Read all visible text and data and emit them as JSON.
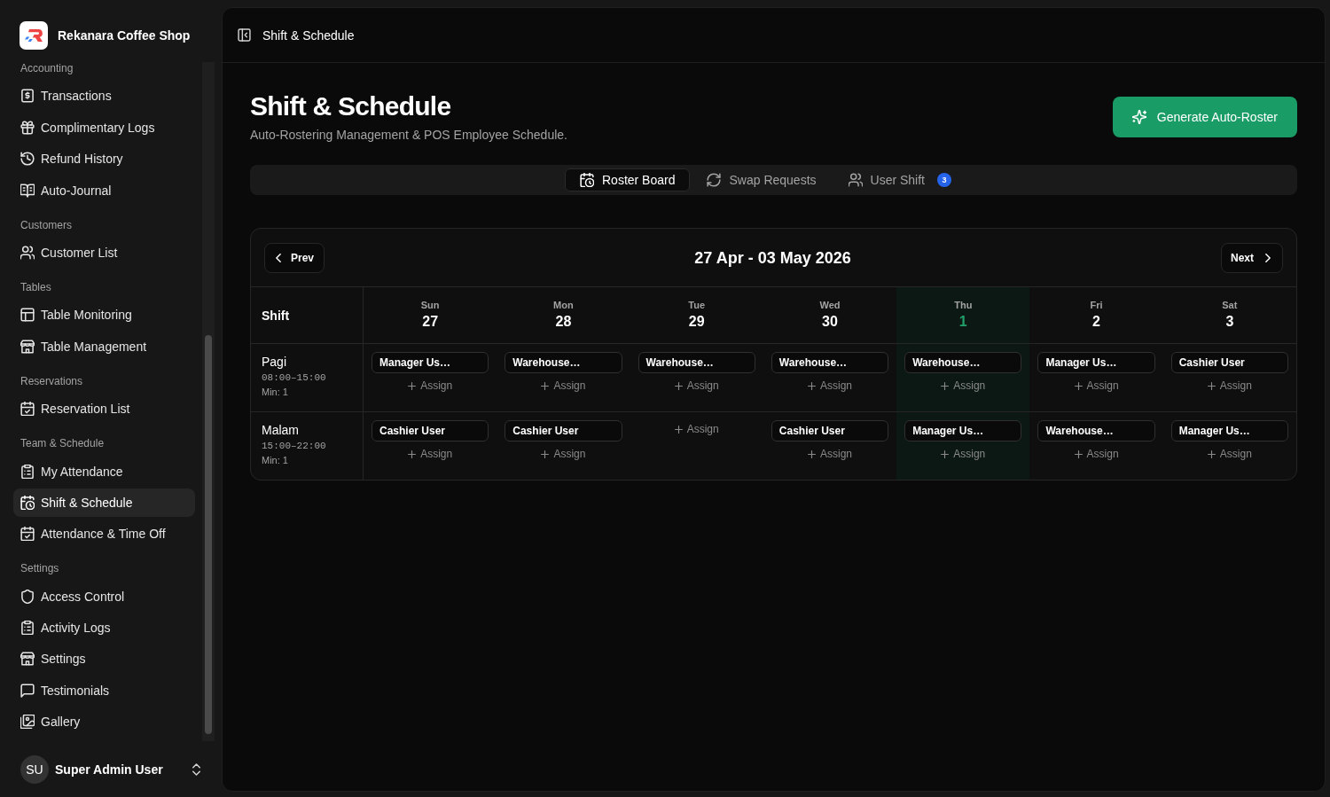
{
  "sidebar": {
    "brand": "Rekanara Coffee Shop",
    "groups": [
      {
        "label": "Accounting",
        "items": [
          {
            "label": "Transactions",
            "selected": false
          },
          {
            "label": "Complimentary Logs",
            "selected": false
          },
          {
            "label": "Refund History",
            "selected": false
          },
          {
            "label": "Auto-Journal",
            "selected": false
          }
        ]
      },
      {
        "label": "Customers",
        "items": [
          {
            "label": "Customer List",
            "selected": false
          }
        ]
      },
      {
        "label": "Tables",
        "items": [
          {
            "label": "Table Monitoring",
            "selected": false
          },
          {
            "label": "Table Management",
            "selected": false
          }
        ]
      },
      {
        "label": "Reservations",
        "items": [
          {
            "label": "Reservation List",
            "selected": false
          }
        ]
      },
      {
        "label": "Team & Schedule",
        "items": [
          {
            "label": "My Attendance",
            "selected": false
          },
          {
            "label": "Shift & Schedule",
            "selected": true
          },
          {
            "label": "Attendance & Time Off",
            "selected": false
          }
        ]
      },
      {
        "label": "Settings",
        "items": [
          {
            "label": "Access Control",
            "selected": false
          },
          {
            "label": "Activity Logs",
            "selected": false
          },
          {
            "label": "Settings",
            "selected": false
          },
          {
            "label": "Testimonials",
            "selected": false
          },
          {
            "label": "Gallery",
            "selected": false
          }
        ]
      }
    ],
    "user": {
      "initials": "SU",
      "name": "Super Admin User"
    }
  },
  "header": {
    "title": "Shift & Schedule"
  },
  "page": {
    "title": "Shift & Schedule",
    "subtitle": "Auto-Rostering Management & POS Employee Schedule.",
    "action": "Generate Auto-Roster"
  },
  "tabs": [
    {
      "label": "Roster Board",
      "selected": true
    },
    {
      "label": "Swap Requests",
      "selected": false
    },
    {
      "label": "User Shift",
      "selected": false,
      "badge": "3"
    }
  ],
  "roster": {
    "prev": "Prev",
    "range": "27 Apr - 03 May 2026",
    "next": "Next",
    "shift_column": "Shift",
    "days": [
      {
        "weekday": "Sun",
        "date": "27",
        "today": false
      },
      {
        "weekday": "Mon",
        "date": "28",
        "today": false
      },
      {
        "weekday": "Tue",
        "date": "29",
        "today": false
      },
      {
        "weekday": "Wed",
        "date": "30",
        "today": false
      },
      {
        "weekday": "Thu",
        "date": "1",
        "today": true
      },
      {
        "weekday": "Fri",
        "date": "2",
        "today": false
      },
      {
        "weekday": "Sat",
        "date": "3",
        "today": false
      }
    ],
    "shifts": [
      {
        "name": "Pagi",
        "time": "08:00–15:00",
        "minimum": "Min: 1",
        "cells": [
          {
            "assignees": [
              "Manager Us…"
            ],
            "assign": "Assign"
          },
          {
            "assignees": [
              "Warehouse…"
            ],
            "assign": "Assign"
          },
          {
            "assignees": [
              "Warehouse…"
            ],
            "assign": "Assign"
          },
          {
            "assignees": [
              "Warehouse…"
            ],
            "assign": "Assign"
          },
          {
            "assignees": [
              "Warehouse…"
            ],
            "assign": "Assign"
          },
          {
            "assignees": [
              "Manager Us…"
            ],
            "assign": "Assign"
          },
          {
            "assignees": [
              "Cashier User"
            ],
            "assign": "Assign"
          }
        ]
      },
      {
        "name": "Malam",
        "time": "15:00–22:00",
        "minimum": "Min: 1",
        "cells": [
          {
            "assignees": [
              "Cashier User"
            ],
            "assign": "Assign"
          },
          {
            "assignees": [
              "Cashier User"
            ],
            "assign": "Assign"
          },
          {
            "assign": "Assign"
          },
          {
            "assignees": [
              "Cashier User"
            ],
            "assign": "Assign"
          },
          {
            "assignees": [
              "Manager Us…"
            ],
            "assign": "Assign"
          },
          {
            "assignees": [
              "Warehouse…"
            ],
            "assign": "Assign"
          },
          {
            "assignees": [
              "Manager Us…"
            ],
            "assign": "Assign"
          }
        ]
      }
    ]
  }
}
